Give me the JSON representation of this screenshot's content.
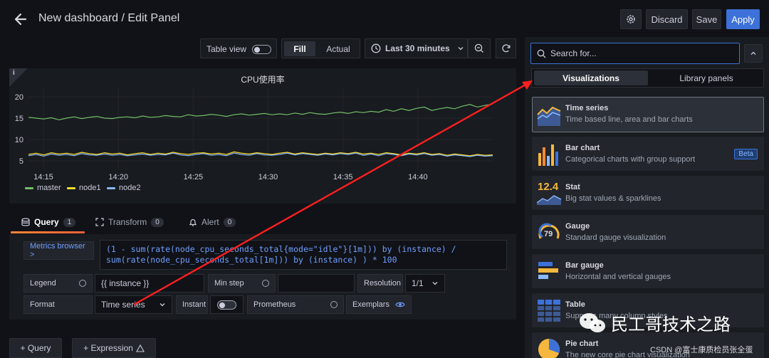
{
  "header": {
    "title": "New dashboard / Edit Panel",
    "discard_label": "Discard",
    "save_label": "Save",
    "apply_label": "Apply"
  },
  "toolbar": {
    "table_view_label": "Table view",
    "fill_label": "Fill",
    "actual_label": "Actual",
    "time_range_label": "Last 30 minutes"
  },
  "panel": {
    "title": "CPU使用率",
    "info": "i"
  },
  "chart_data": {
    "type": "line",
    "title": "CPU使用率",
    "ylim": [
      3,
      22
    ],
    "yticks": [
      "20",
      "15",
      "10",
      "5"
    ],
    "xticks": [
      "14:15",
      "14:20",
      "14:25",
      "14:30",
      "14:35",
      "14:40"
    ],
    "x_range": [
      "14:14",
      "14:45"
    ],
    "series": [
      {
        "name": "master",
        "color": "#73bf69",
        "values": [
          15.2,
          15.0,
          14.8,
          15.1,
          14.6,
          15.0,
          15.3,
          14.9,
          15.2,
          15.4,
          15.0,
          14.9,
          15.2,
          15.3,
          15.1,
          15.5,
          15.2,
          15.3,
          15.6,
          15.4,
          15.3,
          15.8,
          15.5,
          15.6,
          15.9,
          15.7,
          15.4,
          15.8,
          16.0,
          15.7,
          15.9,
          16.1,
          15.8,
          16.0,
          15.8,
          16.2,
          15.9,
          16.3,
          16.0,
          15.9,
          16.2,
          16.4,
          16.1,
          16.5,
          16.3,
          16.6,
          16.4,
          17.0,
          16.6,
          17.2,
          16.8,
          17.3,
          17.6,
          16.8,
          17.2,
          17.5,
          17.2,
          17.8,
          18.2,
          17.6,
          18.0,
          18.3
        ]
      },
      {
        "name": "node1",
        "color": "#fade2a",
        "values": [
          6.5,
          6.8,
          6.4,
          6.9,
          6.6,
          6.8,
          6.5,
          7.0,
          6.7,
          6.5,
          6.9,
          6.6,
          6.8,
          6.4,
          6.7,
          6.9,
          6.5,
          6.8,
          6.6,
          7.0,
          6.7,
          6.5,
          6.8,
          6.9,
          6.6,
          6.8,
          6.5,
          7.1,
          6.8,
          6.6,
          6.9,
          6.7,
          6.5,
          6.8,
          7.0,
          6.6,
          6.9,
          6.7,
          6.5,
          6.8,
          6.6,
          6.9,
          6.7,
          7.0,
          6.6,
          6.8,
          6.5,
          6.9,
          6.7,
          6.4,
          6.8,
          6.6,
          6.9,
          6.5,
          6.7,
          6.3,
          6.6,
          6.4,
          6.2,
          6.5,
          6.3,
          6.4
        ]
      },
      {
        "name": "node2",
        "color": "#8ab8ff",
        "values": [
          6.2,
          6.5,
          6.1,
          6.6,
          6.3,
          6.5,
          6.2,
          6.7,
          6.4,
          6.3,
          6.6,
          6.3,
          6.5,
          6.2,
          6.4,
          6.6,
          6.3,
          6.5,
          6.4,
          6.8,
          6.4,
          6.2,
          6.5,
          6.7,
          6.3,
          6.5,
          6.2,
          6.8,
          6.5,
          6.3,
          6.7,
          6.4,
          6.3,
          6.5,
          6.8,
          6.4,
          6.7,
          6.5,
          6.3,
          6.6,
          6.4,
          6.7,
          6.5,
          6.8,
          6.3,
          6.6,
          6.2,
          6.7,
          6.5,
          6.2,
          6.6,
          6.4,
          6.7,
          6.3,
          6.5,
          6.1,
          6.4,
          6.2,
          6.0,
          6.3,
          6.1,
          6.2
        ]
      }
    ]
  },
  "legend": [
    {
      "name": "master",
      "color": "#73bf69"
    },
    {
      "name": "node1",
      "color": "#fade2a"
    },
    {
      "name": "node2",
      "color": "#8ab8ff"
    }
  ],
  "query_tabs": {
    "query_label": "Query",
    "query_count": "1",
    "transform_label": "Transform",
    "transform_count": "0",
    "alert_label": "Alert",
    "alert_count": "0"
  },
  "editor": {
    "metrics_browser": "Metrics browser >",
    "expr_line1": "(1 - sum(rate(node_cpu_seconds_total{mode=\"idle\"}[1m])) by (instance) /",
    "expr_line2": "sum(rate(node_cpu_seconds_total[1m])) by (instance) ) * 100",
    "legend_label": "Legend",
    "legend_value": "{{ instance }}",
    "min_step_label": "Min step",
    "resolution_label": "Resolution",
    "resolution_value": "1/1",
    "format_label": "Format",
    "format_value": "Time series",
    "instant_label": "Instant",
    "prometheus_label": "Prometheus",
    "exemplars_label": "Exemplars",
    "add_query": "+ Query",
    "add_expression": "+ Expression"
  },
  "sidebar": {
    "search_placeholder": "Search for...",
    "tab_visualizations": "Visualizations",
    "tab_library": "Library panels",
    "items": [
      {
        "title": "Time series",
        "desc": "Time based line, area and bar charts",
        "icon": "time-series-icon"
      },
      {
        "title": "Bar chart",
        "desc": "Categorical charts with group support",
        "icon": "bar-chart-icon",
        "badge": "Beta"
      },
      {
        "title": "Stat",
        "desc": "Big stat values & sparklines",
        "icon": "stat-icon",
        "icon_text": "12.4"
      },
      {
        "title": "Gauge",
        "desc": "Standard gauge visualization",
        "icon": "gauge-icon",
        "icon_text": "79"
      },
      {
        "title": "Bar gauge",
        "desc": "Horizontal and vertical gauges",
        "icon": "bar-gauge-icon"
      },
      {
        "title": "Table",
        "desc": "Supports many column styles",
        "icon": "table-icon"
      },
      {
        "title": "Pie chart",
        "desc": "The new core pie chart visualization",
        "icon": "pie-chart-icon"
      }
    ]
  },
  "watermark": {
    "brand": "民工哥技术之路",
    "credit": "CSDN @富士康质检员张全蛋"
  }
}
